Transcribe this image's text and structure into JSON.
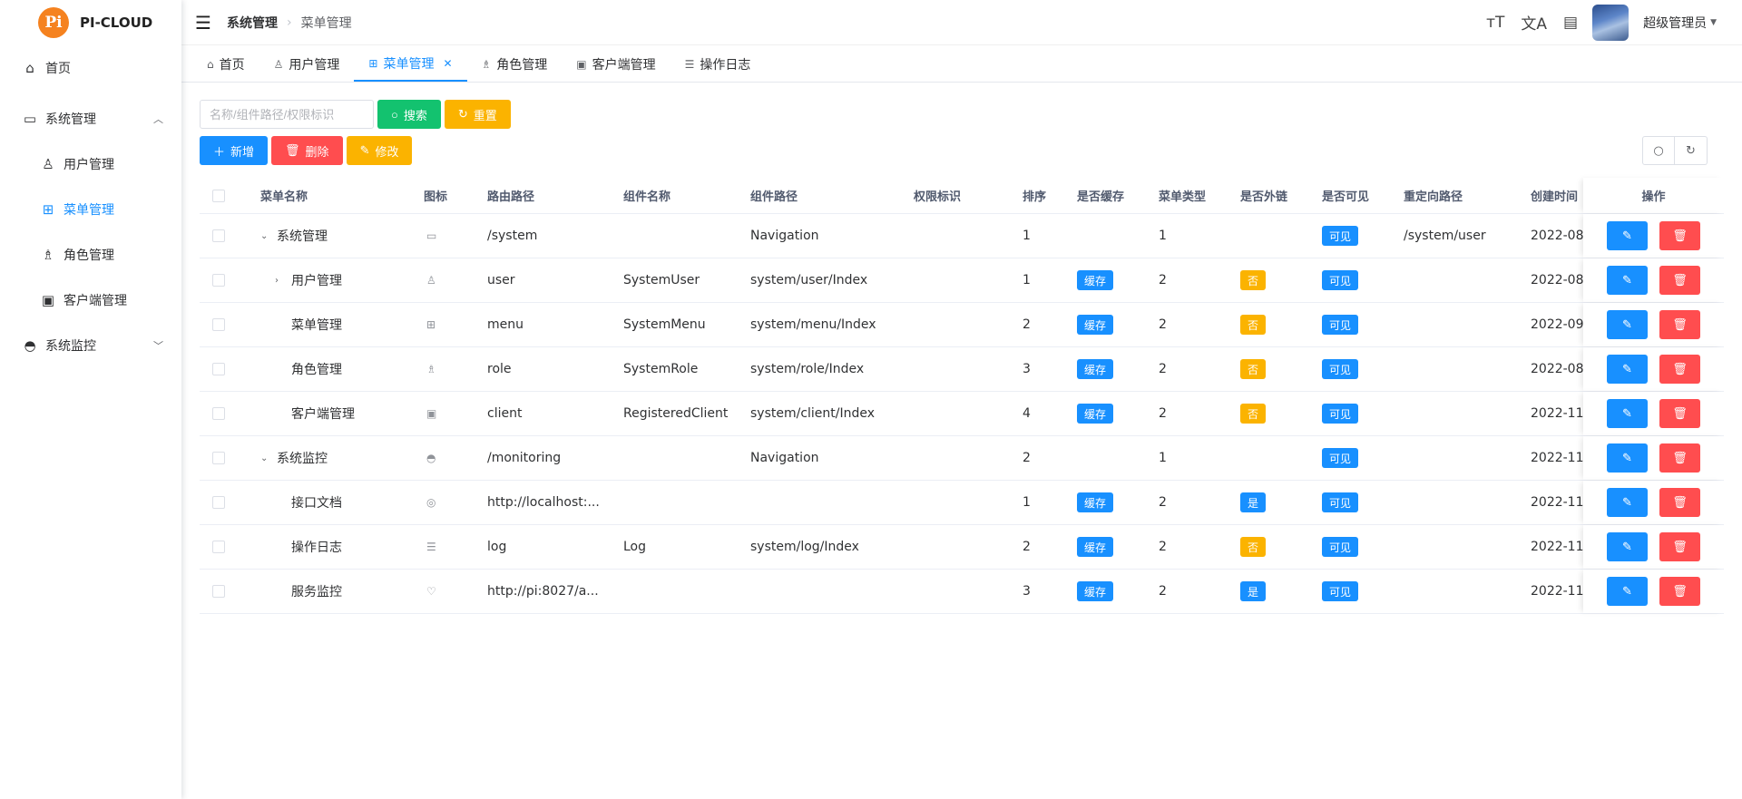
{
  "app": {
    "logo_text": "PI-CLOUD",
    "logo_badge": "Pi"
  },
  "sidebar": {
    "items": [
      {
        "label": "首页",
        "icon": "home-icon",
        "glyph": "⌂"
      },
      {
        "label": "系统管理",
        "icon": "monitor-icon",
        "glyph": "▭"
      },
      {
        "label": "用户管理",
        "icon": "user-icon",
        "glyph": "♙"
      },
      {
        "label": "菜单管理",
        "icon": "grid-icon",
        "glyph": "⊞"
      },
      {
        "label": "角色管理",
        "icon": "role-icon",
        "glyph": "♗"
      },
      {
        "label": "客户端管理",
        "icon": "client-icon",
        "glyph": "▣"
      },
      {
        "label": "系统监控",
        "icon": "dashboard-icon",
        "glyph": "◓"
      }
    ]
  },
  "header": {
    "breadcrumb": [
      "系统管理",
      "菜单管理"
    ],
    "user_name": "超级管理员"
  },
  "tabs": [
    {
      "label": "首页",
      "glyph": "⌂"
    },
    {
      "label": "用户管理",
      "glyph": "♙"
    },
    {
      "label": "菜单管理",
      "glyph": "⊞"
    },
    {
      "label": "角色管理",
      "glyph": "♗"
    },
    {
      "label": "客户端管理",
      "glyph": "▣"
    },
    {
      "label": "操作日志",
      "glyph": "☰"
    }
  ],
  "toolbar": {
    "search_placeholder": "名称/组件路径/权限标识",
    "search_label": "搜索",
    "reset_label": "重置",
    "add_label": "新增",
    "delete_label": "删除",
    "edit_label": "修改"
  },
  "table": {
    "columns": [
      "菜单名称",
      "图标",
      "路由路径",
      "组件名称",
      "组件路径",
      "权限标识",
      "排序",
      "是否缓存",
      "菜单类型",
      "是否外链",
      "是否可见",
      "重定向路径",
      "创建时间",
      "操作"
    ],
    "rows": [
      {
        "level": 0,
        "toggle": "⌄",
        "name": "系统管理",
        "icon": "▭",
        "path": "/system",
        "comp_name": "",
        "comp_path": "Navigation",
        "perm": "",
        "sort": "1",
        "cache": "",
        "type": "1",
        "ext": "",
        "visible": "可见",
        "redirect": "/system/user",
        "created": "2022-08-"
      },
      {
        "level": 1,
        "toggle": "›",
        "name": "用户管理",
        "icon": "♙",
        "path": "user",
        "comp_name": "SystemUser",
        "comp_path": "system/user/Index",
        "perm": "",
        "sort": "1",
        "cache": "缓存",
        "type": "2",
        "ext": "否",
        "visible": "可见",
        "redirect": "",
        "created": "2022-08-"
      },
      {
        "level": 1,
        "toggle": "",
        "name": "菜单管理",
        "icon": "⊞",
        "path": "menu",
        "comp_name": "SystemMenu",
        "comp_path": "system/menu/Index",
        "perm": "",
        "sort": "2",
        "cache": "缓存",
        "type": "2",
        "ext": "否",
        "visible": "可见",
        "redirect": "",
        "created": "2022-09-"
      },
      {
        "level": 1,
        "toggle": "",
        "name": "角色管理",
        "icon": "♗",
        "path": "role",
        "comp_name": "SystemRole",
        "comp_path": "system/role/Index",
        "perm": "",
        "sort": "3",
        "cache": "缓存",
        "type": "2",
        "ext": "否",
        "visible": "可见",
        "redirect": "",
        "created": "2022-08-"
      },
      {
        "level": 1,
        "toggle": "",
        "name": "客户端管理",
        "icon": "▣",
        "path": "client",
        "comp_name": "RegisteredClient",
        "comp_path": "system/client/Index",
        "perm": "",
        "sort": "4",
        "cache": "缓存",
        "type": "2",
        "ext": "否",
        "visible": "可见",
        "redirect": "",
        "created": "2022-11-"
      },
      {
        "level": 0,
        "toggle": "⌄",
        "name": "系统监控",
        "icon": "◓",
        "path": "/monitoring",
        "comp_name": "",
        "comp_path": "Navigation",
        "perm": "",
        "sort": "2",
        "cache": "",
        "type": "1",
        "ext": "",
        "visible": "可见",
        "redirect": "",
        "created": "2022-11-"
      },
      {
        "level": 1,
        "toggle": "",
        "name": "接口文档",
        "icon": "◎",
        "path": "http://localhost:...",
        "comp_name": "",
        "comp_path": "",
        "perm": "",
        "sort": "1",
        "cache": "缓存",
        "type": "2",
        "ext": "是",
        "visible": "可见",
        "redirect": "",
        "created": "2022-11-"
      },
      {
        "level": 1,
        "toggle": "",
        "name": "操作日志",
        "icon": "☰",
        "path": "log",
        "comp_name": "Log",
        "comp_path": "system/log/Index",
        "perm": "",
        "sort": "2",
        "cache": "缓存",
        "type": "2",
        "ext": "否",
        "visible": "可见",
        "redirect": "",
        "created": "2022-11-"
      },
      {
        "level": 1,
        "toggle": "",
        "name": "服务监控",
        "icon": "♡",
        "path": "http://pi:8027/a...",
        "comp_name": "",
        "comp_path": "",
        "perm": "",
        "sort": "3",
        "cache": "缓存",
        "type": "2",
        "ext": "是",
        "visible": "可见",
        "redirect": "",
        "created": "2022-11-"
      }
    ]
  },
  "colors": {
    "primary": "#1890ff",
    "success": "#13c26f",
    "warning": "#fbb300",
    "danger": "#ff4d4f"
  }
}
